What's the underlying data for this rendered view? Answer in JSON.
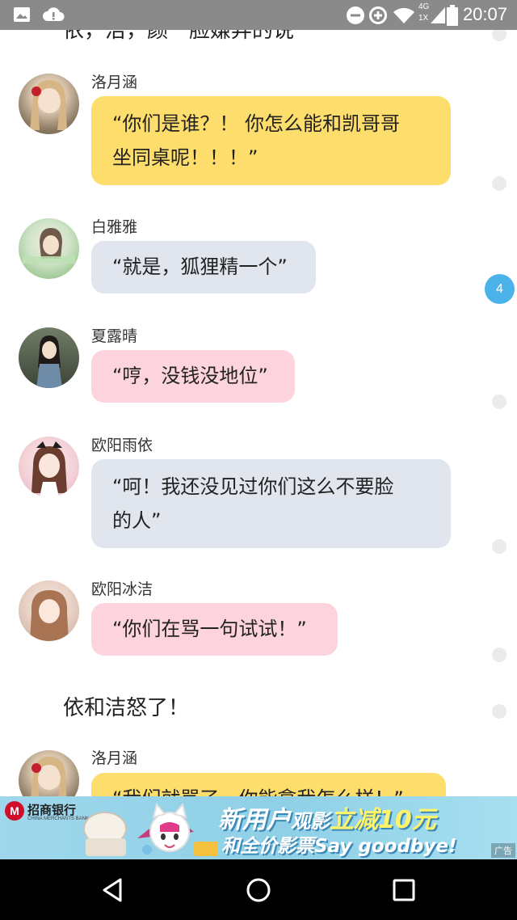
{
  "status_bar": {
    "time": "20:07",
    "icons": [
      "image-icon",
      "alert-icon",
      "do-not-disturb-icon",
      "data-saver-icon",
      "wifi-icon",
      "cellular-4g-icon",
      "battery-icon"
    ],
    "network_label": "4G",
    "sim_label": "1X"
  },
  "chat": {
    "top_narration": "依，洁，颜一脸嫌弃的说",
    "messages": [
      {
        "name": "洛月涵",
        "line1": "“你们是谁？！ 你怎么能和凯哥哥",
        "line2": "坐同桌呢！！！”",
        "color": "#fdde6c"
      },
      {
        "name": "白雅雅",
        "line1": "“就是，狐狸精一个”",
        "color": "#e1e6ee"
      },
      {
        "name": "夏露晴",
        "line1": "“哼，没钱没地位”",
        "color": "#fdd3dd"
      },
      {
        "name": "欧阳雨依",
        "line1": "“呵！我还没见过你们这么不要脸",
        "line2": "的人”",
        "color": "#e1e6ee"
      },
      {
        "name": "欧阳冰洁",
        "line1": "“你们在骂一句试试！”",
        "color": "#fdd3dd"
      },
      {
        "name": "洛月涵",
        "line1": "“我们就骂了，你能拿我怎么样！”",
        "color": "#fdde6c"
      }
    ],
    "narration_2": "依和洁怒了！",
    "comment_count": "4"
  },
  "ad": {
    "bank_logo": "M",
    "bank_name": "招商银行",
    "bank_sub": "CHINA MERCHANTS BANK",
    "headline_a": "新用户",
    "headline_b": "观影",
    "headline_c": "立减10元",
    "subline": "和全价影票Say goodbye!",
    "ad_label": "广告"
  },
  "nav_bar": {
    "icons": [
      "back-icon",
      "home-icon",
      "recents-icon"
    ]
  }
}
